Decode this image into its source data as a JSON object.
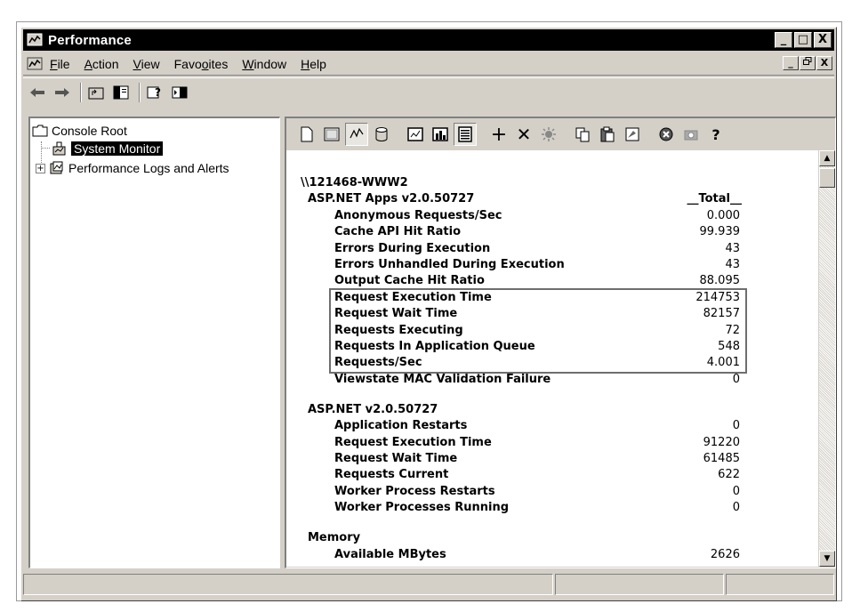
{
  "window": {
    "title": "Performance",
    "caption_minimize": "_",
    "caption_maximize": "□",
    "caption_close": "X"
  },
  "menu": {
    "items": [
      "File",
      "Action",
      "View",
      "Favorites",
      "Window",
      "Help"
    ],
    "accelerators": [
      "F",
      "A",
      "V",
      "o",
      "W",
      "H"
    ]
  },
  "tree": {
    "console_root": "Console Root",
    "system_monitor": "System Monitor",
    "perf_logs": "Performance Logs and Alerts",
    "expander": "+"
  },
  "report": {
    "machine": "\\\\121468-WWW2",
    "sections": [
      {
        "object": "ASP.NET Apps v2.0.50727",
        "instance": "__Total__",
        "counters": [
          {
            "name": "Anonymous Requests/Sec",
            "value": "0.000"
          },
          {
            "name": "Cache API Hit Ratio",
            "value": "99.939"
          },
          {
            "name": "Errors During Execution",
            "value": "43"
          },
          {
            "name": "Errors Unhandled During Execution",
            "value": "43"
          },
          {
            "name": "Output Cache Hit Ratio",
            "value": "88.095"
          },
          {
            "name": "Request Execution Time",
            "value": "214753"
          },
          {
            "name": "Request Wait Time",
            "value": "82157"
          },
          {
            "name": "Requests Executing",
            "value": "72"
          },
          {
            "name": "Requests In Application Queue",
            "value": "548"
          },
          {
            "name": "Requests/Sec",
            "value": "4.001"
          },
          {
            "name": "Viewstate MAC Validation Failure",
            "value": "0"
          }
        ]
      },
      {
        "object": "ASP.NET v2.0.50727",
        "counters": [
          {
            "name": "Application Restarts",
            "value": "0"
          },
          {
            "name": "Request Execution Time",
            "value": "91220"
          },
          {
            "name": "Request Wait Time",
            "value": "61485"
          },
          {
            "name": "Requests Current",
            "value": "622"
          },
          {
            "name": "Worker Process Restarts",
            "value": "0"
          },
          {
            "name": "Worker Processes Running",
            "value": "0"
          }
        ]
      },
      {
        "object": "Memory",
        "counters": [
          {
            "name": "Available MBytes",
            "value": "2626"
          }
        ]
      }
    ]
  },
  "scrollbar": {
    "up_arrow": "▲",
    "down_arrow": "▼"
  },
  "sm_toolbar": {
    "icons": [
      "new-counter-set-icon",
      "clear-display-icon",
      "view-current-activity-icon",
      "view-log-data-icon",
      "view-graph-icon",
      "view-histogram-icon",
      "view-report-icon",
      "add-counter-icon",
      "delete-counter-icon",
      "highlight-icon",
      "copy-properties-icon",
      "paste-counter-list-icon",
      "properties-icon",
      "freeze-display-icon",
      "update-data-icon",
      "help-icon"
    ],
    "glyphs": {
      "add-counter-icon": "+",
      "delete-counter-icon": "✕",
      "help-icon": "?"
    }
  }
}
